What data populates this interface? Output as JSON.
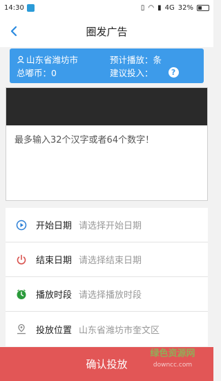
{
  "status_bar": {
    "time": "14:30",
    "network": "4G",
    "battery": "32%"
  },
  "nav": {
    "title": "圈发广告"
  },
  "info_card": {
    "location": "山东省潍坊市",
    "estimated_play": "预计播放：条",
    "total_coins": "总嘟币：0",
    "suggested_input": "建议投入：",
    "help": "?"
  },
  "preview": {
    "placeholder": "最多输入32个汉字或者64个数字！"
  },
  "form": {
    "rows": [
      {
        "label": "开始日期",
        "value": "请选择开始日期",
        "icon": "play-circle-icon"
      },
      {
        "label": "结束日期",
        "value": "请选择结束日期",
        "icon": "power-icon"
      },
      {
        "label": "播放时段",
        "value": "请选择播放时段",
        "icon": "clock-icon"
      },
      {
        "label": "投放位置",
        "value": "山东省潍坊市奎文区",
        "icon": "location-pin-icon"
      }
    ]
  },
  "confirm_button": {
    "label": "确认投放"
  },
  "watermark": {
    "text": "绿色资源网",
    "url": "downcc.com"
  }
}
